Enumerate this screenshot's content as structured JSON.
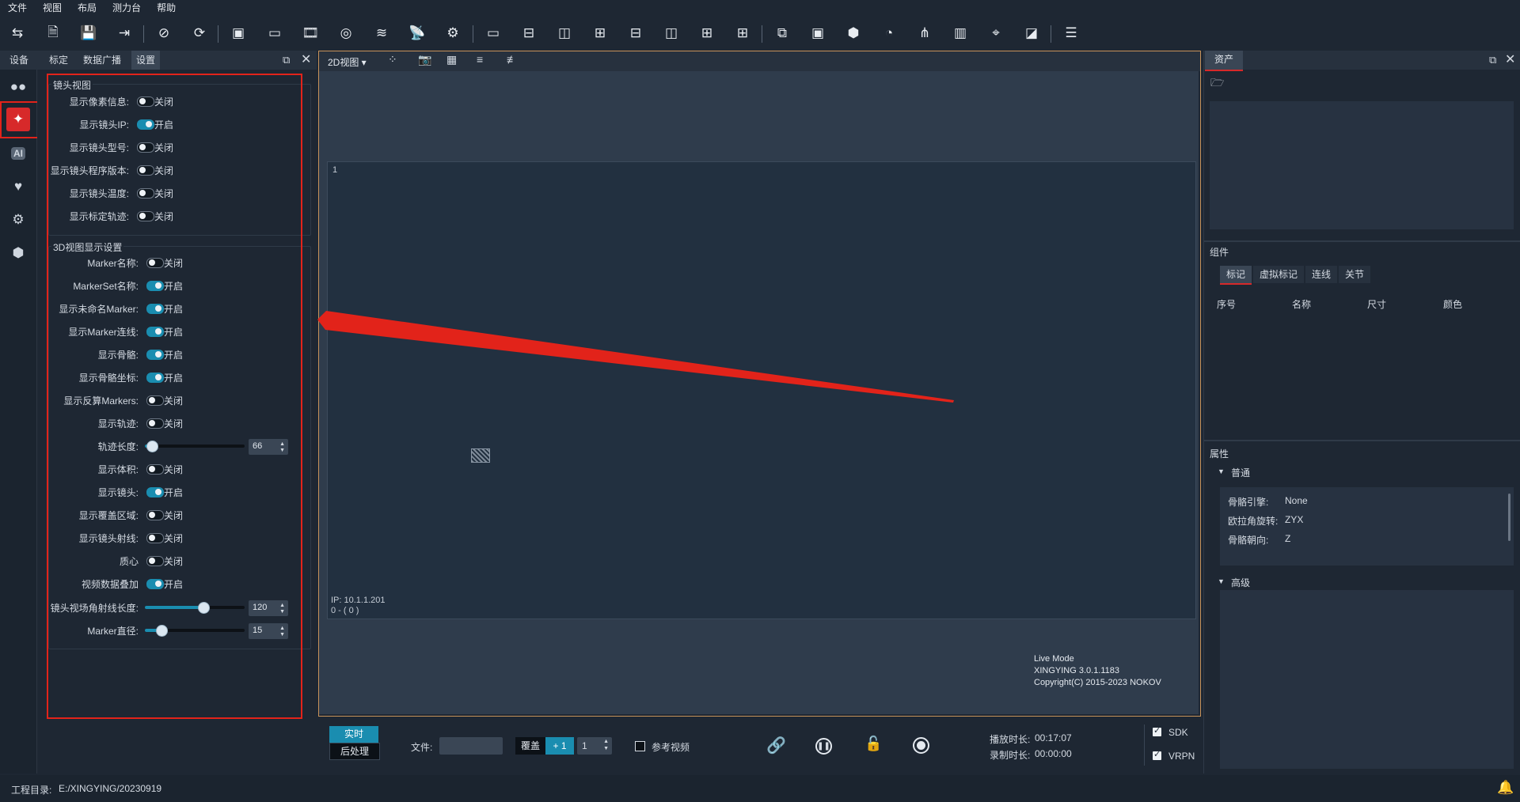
{
  "menu": {
    "file": "文件",
    "view": "视图",
    "layout": "布局",
    "console": "测力台",
    "help": "帮助"
  },
  "left": {
    "tabs": [
      "设备",
      "标定",
      "数据广播",
      "设置"
    ],
    "group1": {
      "title": "镜头视图",
      "rows": [
        {
          "label": "显示像素信息:",
          "state": "关闭",
          "on": false
        },
        {
          "label": "显示镜头IP:",
          "state": "开启",
          "on": true
        },
        {
          "label": "显示镜头型号:",
          "state": "关闭",
          "on": false
        },
        {
          "label": "显示镜头程序版本:",
          "state": "关闭",
          "on": false
        },
        {
          "label": "显示镜头温度:",
          "state": "关闭",
          "on": false
        },
        {
          "label": "显示标定轨迹:",
          "state": "关闭",
          "on": false
        }
      ]
    },
    "group2": {
      "title": "3D视图显示设置",
      "rows": [
        {
          "label": "Marker名称:",
          "state": "关闭",
          "on": false
        },
        {
          "label": "MarkerSet名称:",
          "state": "开启",
          "on": true
        },
        {
          "label": "显示未命名Marker:",
          "state": "开启",
          "on": true
        },
        {
          "label": "显示Marker连线:",
          "state": "开启",
          "on": true
        },
        {
          "label": "显示骨骼:",
          "state": "开启",
          "on": true
        },
        {
          "label": "显示骨骼坐标:",
          "state": "开启",
          "on": true
        },
        {
          "label": "显示反算Markers:",
          "state": "关闭",
          "on": false
        },
        {
          "label": "显示轨迹:",
          "state": "关闭",
          "on": false
        }
      ],
      "trail": {
        "label": "轨迹长度:",
        "value": "66",
        "fraction": 0.06
      },
      "rows2": [
        {
          "label": "显示体积:",
          "state": "关闭",
          "on": false
        },
        {
          "label": "显示镜头:",
          "state": "开启",
          "on": true
        },
        {
          "label": "显示覆盖区域:",
          "state": "关闭",
          "on": false
        },
        {
          "label": "显示镜头射线:",
          "state": "关闭",
          "on": false
        },
        {
          "label": "质心",
          "state": "关闭",
          "on": false
        },
        {
          "label": "视频数据叠加",
          "state": "开启",
          "on": true
        }
      ],
      "fov": {
        "label": "镜头视场角射线长度:",
        "value": "120",
        "fraction": 0.58
      },
      "marker": {
        "label": "Marker直径:",
        "value": "15",
        "fraction": 0.16
      }
    }
  },
  "view": {
    "mode": "2D视图",
    "camera_number": "1",
    "ip_line": "IP: 10.1.1.201",
    "coord_line": "0 - ( 0 )",
    "live_mode": "Live Mode",
    "version": "XINGYING 3.0.1.1183",
    "copyright": "Copyright(C) 2015-2023 NOKOV"
  },
  "control": {
    "realtime": "实时",
    "post": "后处理",
    "file_label": "文件:",
    "overlay": "覆盖",
    "plus": "+ 1",
    "frame_value": "1",
    "ref_video": "参考视频",
    "play_label": "播放时长:",
    "play_time": "00:17:07",
    "rec_label": "录制时长:",
    "rec_time": "00:00:00",
    "sdk": "SDK",
    "vrpn": "VRPN"
  },
  "status": {
    "label": "工程目录:",
    "path": "E:/XINGYING/20230919"
  },
  "right": {
    "assets": "资产",
    "components": "组件",
    "comp_tabs": [
      "标记",
      "虚拟标记",
      "连线",
      "关节"
    ],
    "columns": [
      "序号",
      "名称",
      "尺寸",
      "颜色"
    ],
    "props": "属性",
    "general": "普通",
    "props_rows": [
      {
        "k": "骨骼引擎:",
        "v": "None"
      },
      {
        "k": "欧拉角旋转:",
        "v": "ZYX"
      },
      {
        "k": "骨骼朝向:",
        "v": "Z"
      }
    ],
    "advanced": "高级"
  },
  "colors": {
    "accent": "#1a8db0",
    "annotation": "#e2231a",
    "frame": "#c8935a"
  }
}
